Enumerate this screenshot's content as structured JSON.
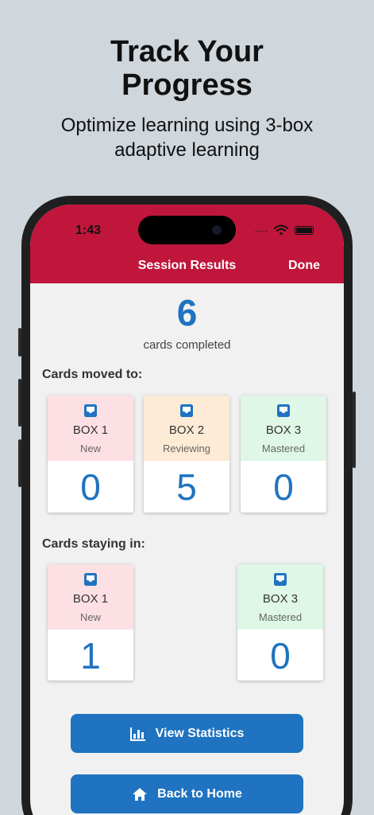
{
  "promo": {
    "title_line1": "Track Your",
    "title_line2": "Progress",
    "subtitle_line1": "Optimize learning using 3-box",
    "subtitle_line2": "adaptive learning"
  },
  "status_bar": {
    "time": "1:43",
    "dots": "••••"
  },
  "nav": {
    "title": "Session Results",
    "done_label": "Done"
  },
  "summary": {
    "count": "6",
    "label": "cards completed"
  },
  "moved": {
    "title": "Cards moved to:",
    "cards": [
      {
        "box": "BOX 1",
        "status": "New",
        "count": "0",
        "color": "#fde0e4"
      },
      {
        "box": "BOX 2",
        "status": "Reviewing",
        "count": "5",
        "color": "#fdebd6"
      },
      {
        "box": "BOX 3",
        "status": "Mastered",
        "count": "0",
        "color": "#dff7e6"
      }
    ]
  },
  "staying": {
    "title": "Cards staying in:",
    "cards": [
      {
        "box": "BOX 1",
        "status": "New",
        "count": "1",
        "color": "#fde0e4"
      },
      {
        "box": "BOX 3",
        "status": "Mastered",
        "count": "0",
        "color": "#dff7e6"
      }
    ]
  },
  "buttons": {
    "view_statistics": "View Statistics",
    "back_to_home": "Back to Home"
  },
  "icons": [
    "inbox-icon",
    "bar-chart-icon",
    "home-icon",
    "wifi-icon",
    "battery-icon"
  ],
  "colors": {
    "accent": "#c0163c",
    "primary": "#1f73c0",
    "background": "#cfd6dc"
  }
}
